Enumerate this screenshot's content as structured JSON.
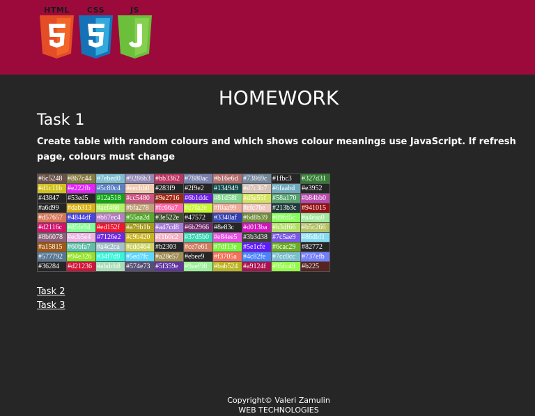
{
  "header": {
    "logos": [
      {
        "label": "HTML",
        "digit": "5",
        "color": "#e44d26",
        "shade": "#f16529"
      },
      {
        "label": "CSS",
        "digit": "3",
        "color": "#1572b6",
        "shade": "#33a9dc"
      },
      {
        "label": "JS",
        "digit": "J",
        "color": "#6bbf3b",
        "shade": "#86d04f"
      }
    ],
    "background": "#9c0a3b"
  },
  "main_title": "HOMEWORK",
  "task": {
    "title": "Task 1",
    "description": "Create table with random colours and which shows colour meanings use JavaScript. If refresh page, colours must change"
  },
  "color_table": [
    [
      "#6c5248",
      "#867c44",
      "#7ebed0",
      "#9286b3",
      "#bb3362",
      "#7880ac",
      "#b16e6d",
      "#73869c",
      "#1fbc3",
      "#327d31"
    ],
    [
      "#d1c11b",
      "#e222fb",
      "#5c80c4",
      "#eecbb0",
      "#283f9",
      "#2f9e2",
      "#134949",
      "#d7c3b7",
      "#6faabd",
      "#e3952"
    ],
    [
      "#43847",
      "#53ed5",
      "#12a518",
      "#cc5480",
      "#9e2716",
      "#6b1ddc",
      "#81d58f",
      "#d5e55f",
      "#58a170",
      "#b84bb0"
    ],
    [
      "#a6d99",
      "#dab313",
      "#aef468",
      "#bfa278",
      "#fc66a7",
      "#c7fa2e",
      "#f0aa99",
      "#efc7be",
      "#213b3c",
      "#941015"
    ],
    [
      "#d57657",
      "#4844df",
      "#b67ec4",
      "#55aa2d",
      "#3e522e",
      "#47572",
      "#3340af",
      "#6d8b39",
      "#89fd5c",
      "#a4eaa0"
    ],
    [
      "#d2116c",
      "#85fe94",
      "#ed152f",
      "#a79b1b",
      "#a47cd8",
      "#6b2966",
      "#8e83c",
      "#d013ba",
      "#b3df66",
      "#b5c266"
    ],
    [
      "#8b6078",
      "#ecb5e4",
      "#7126e2",
      "#c9b420",
      "#f1b0c2",
      "#37d5b0",
      "#e84ee5",
      "#3b3d38",
      "#7c5ae9",
      "#86dbf1"
    ],
    [
      "#a15815",
      "#60bfa7",
      "#a4c2ca",
      "#cdd464",
      "#b2303",
      "#ce7e61",
      "#7df13e",
      "#5e1cfe",
      "#6cac29",
      "#82772"
    ],
    [
      "#577792",
      "#94e326",
      "#34f7d9",
      "#5ed7fc",
      "#a28e57",
      "#ebee9",
      "#f3705a",
      "#4c82fe",
      "#7cc0cc",
      "#737efb"
    ],
    [
      "#36284",
      "#d21236",
      "#abdcb8",
      "#574e73",
      "#5f359e",
      "#9aef98",
      "#bab524",
      "#a9124f",
      "#95fc49",
      "#b225"
    ]
  ],
  "links": [
    "Task 2",
    "Task 3"
  ],
  "footer": {
    "line1": "Copyright© Valeri Zamulin",
    "line2": "WEB TECHNOLOGIES"
  }
}
